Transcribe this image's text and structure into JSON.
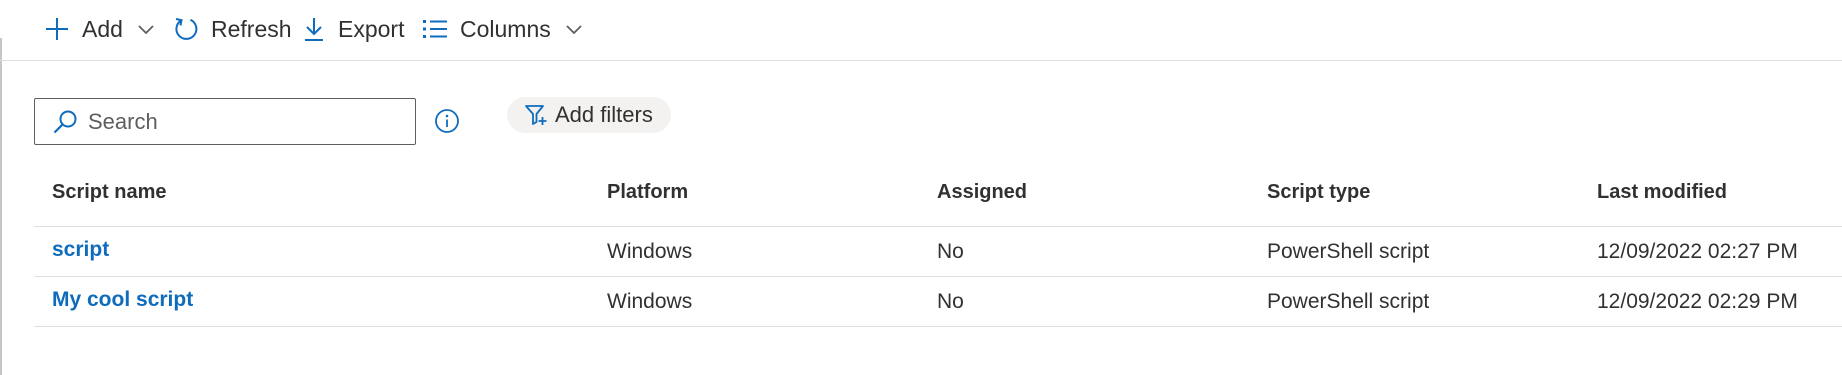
{
  "toolbar": {
    "add_label": "Add",
    "refresh_label": "Refresh",
    "export_label": "Export",
    "columns_label": "Columns"
  },
  "search": {
    "placeholder": "Search",
    "value": ""
  },
  "filters": {
    "add_filters_label": "Add filters"
  },
  "table": {
    "columns": [
      "Script name",
      "Platform",
      "Assigned",
      "Script type",
      "Last modified"
    ],
    "rows": [
      {
        "name": "script",
        "platform": "Windows",
        "assigned": "No",
        "type": "PowerShell script",
        "modified": "12/09/2022 02:27 PM"
      },
      {
        "name": "My cool script",
        "platform": "Windows",
        "assigned": "No",
        "type": "PowerShell script",
        "modified": "12/09/2022 02:29 PM"
      }
    ]
  },
  "icons": {
    "accent": "#0f6cbd",
    "add": "plus-icon",
    "refresh": "refresh-icon",
    "export": "download-icon",
    "columns": "list-icon",
    "search": "search-icon",
    "info": "info-icon",
    "filter": "filter-icon"
  }
}
